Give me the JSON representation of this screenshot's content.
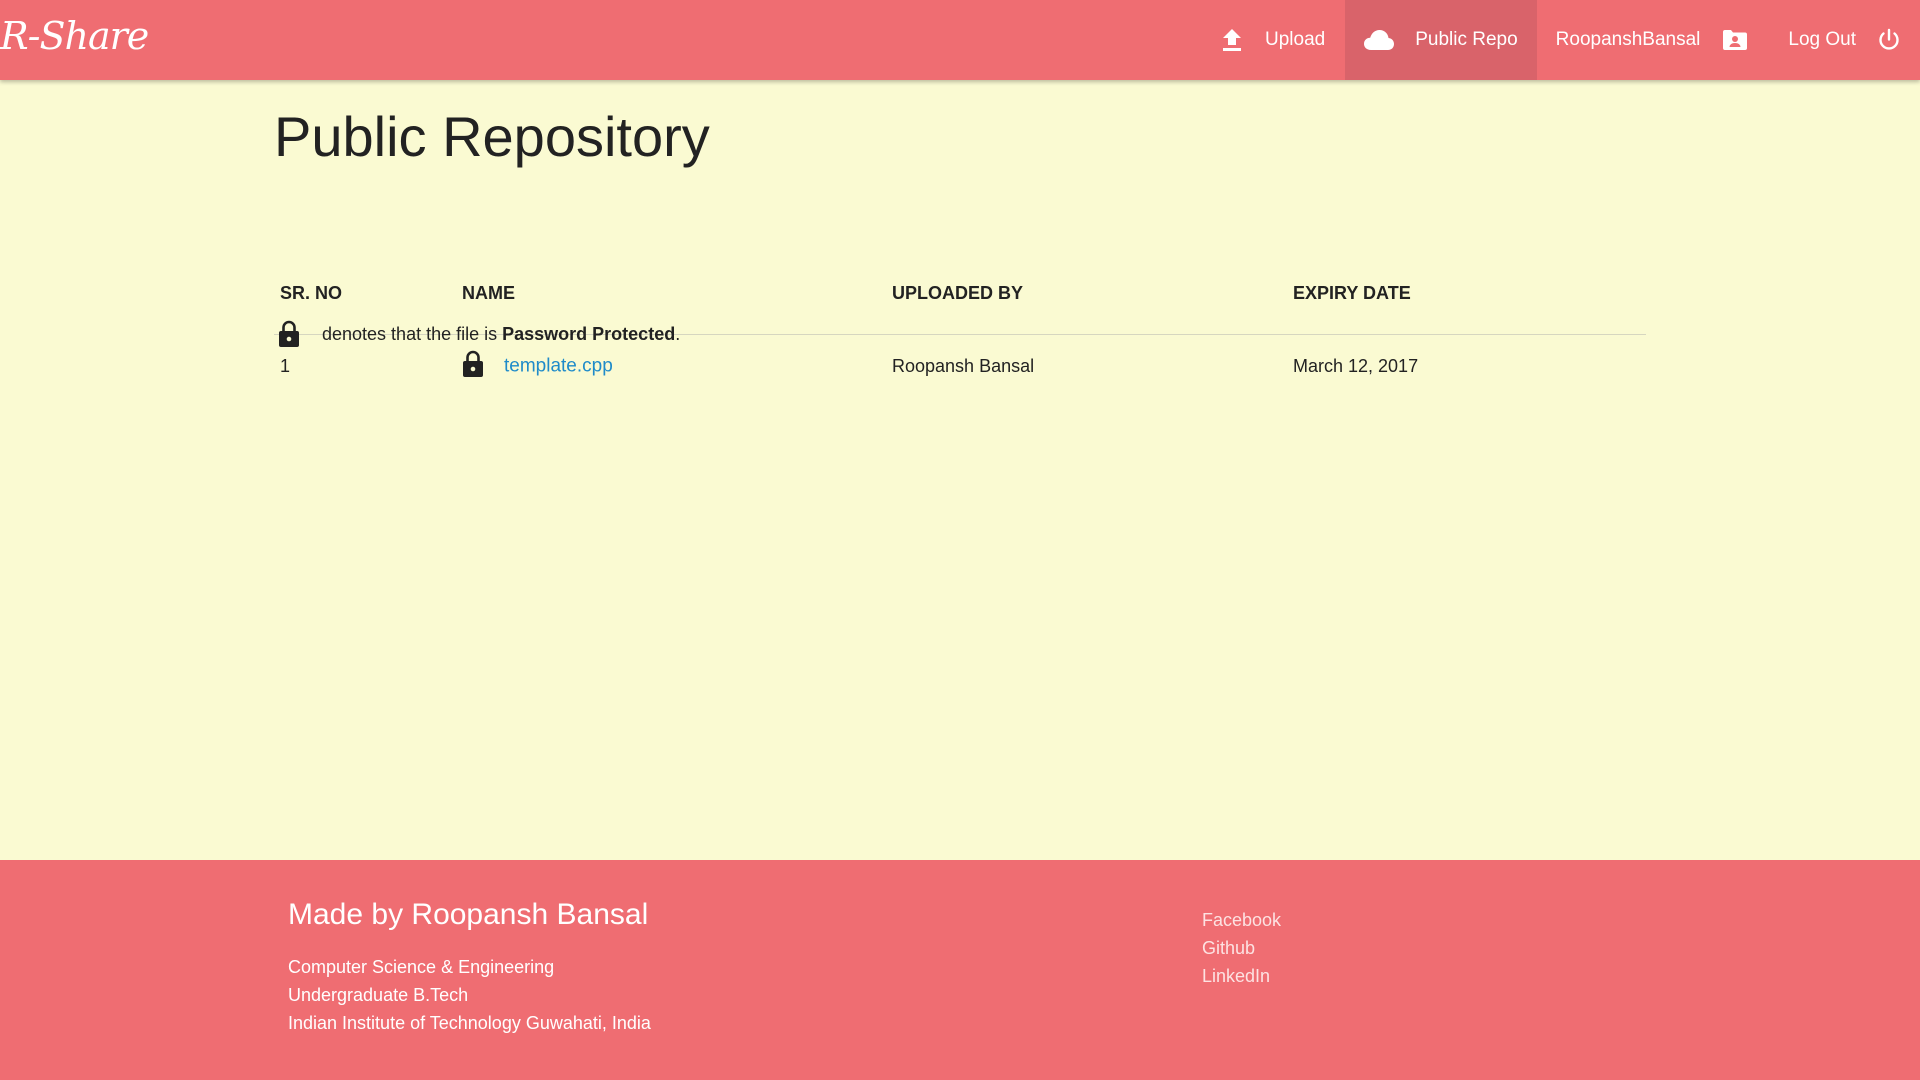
{
  "app": {
    "brand": "R-Share"
  },
  "nav": {
    "upload": {
      "label": "Upload",
      "icon": "upload-icon"
    },
    "public_repo": {
      "label": "Public Repo",
      "icon": "cloud-icon"
    },
    "user": {
      "label": "RoopanshBansal",
      "icon": "account-box-icon"
    },
    "logout": {
      "label": "Log Out",
      "icon": "power-icon"
    }
  },
  "page": {
    "title": "Public Repository"
  },
  "table": {
    "headers": {
      "sr": "SR. NO",
      "name": "NAME",
      "uploaded_by": "UPLOADED BY",
      "expiry": "EXPIRY DATE"
    },
    "rows": [
      {
        "sr": "1",
        "name": "template.cpp",
        "locked": true,
        "uploaded_by": "Roopansh Bansal",
        "expiry": "March 12, 2017"
      }
    ]
  },
  "legend": {
    "prefix": "denotes that the file is",
    "bold": "Password Protected",
    "suffix": "."
  },
  "footer": {
    "title": "Made by Roopansh Bansal",
    "lines": [
      "Computer Science & Engineering",
      "Undergraduate B.Tech",
      "Indian Institute of Technology Guwahati, India"
    ],
    "links": [
      "Facebook",
      "Github",
      "LinkedIn"
    ]
  },
  "colors": {
    "nav_bg": "#ef6d72",
    "nav_active": "#d9636a",
    "page_bg": "#fafad2",
    "link": "#1f8bc9",
    "footer_bg": "#ef6d72"
  }
}
